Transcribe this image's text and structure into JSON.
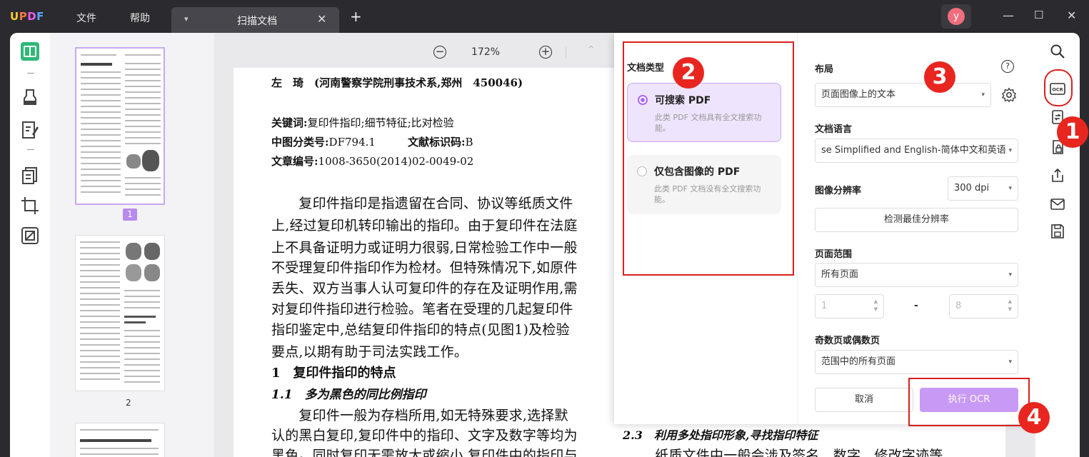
{
  "app": {
    "logo": "UPDF",
    "menu_file": "文件",
    "menu_help": "帮助",
    "tab_title": "扫描文档",
    "tab_dropdown": "▾",
    "tab_close": "✕",
    "new_tab": "+",
    "user_initial": "y"
  },
  "window": {
    "minimize": "—",
    "maximize": "☐",
    "close": "✕"
  },
  "toolbar": {
    "zoom_out": "−",
    "zoom": "172%",
    "zoom_in": "+",
    "nav_up": "⌃"
  },
  "thumbnails": {
    "page1_num": "1",
    "page2_num": "2"
  },
  "document": {
    "author_line": "左　琦　(河南警察学院刑事技术系,郑州　450046)",
    "keywords_label": "关键词:",
    "keywords_value": "复印件指印;细节特征;比对检验",
    "clc_label": "中图分类号:",
    "clc_value": "DF794.1",
    "doccode_label": "文献标识码:",
    "doccode_value": "B",
    "article_label": "文章编号:",
    "article_value": "1008-3650(2014)02-0049-02",
    "para1": [
      "　　复印件指印是指遗留在合同、协议等纸质文件",
      "上,经过复印机转印输出的指印。由于复印件在法庭",
      "上不具备证明力或证明力很弱,日常检验工作中一般",
      "不受理复印件指印作为检材。但特殊情况下,如原件",
      "丢失、双方当事人认可复印件的存在及证明作用,需",
      "对复印件指印进行检验。笔者在受理的几起复印件",
      "指印鉴定中,总结复印件指印的特点(见图1)及检验",
      "要点,以期有助于司法实践工作。"
    ],
    "heading1": "1　复印件指印的特点",
    "heading11": "1.1　多为黑色的同比例指印",
    "para2": [
      "　　复印件一般为存档所用,如无特殊要求,选择默",
      "认的黑白复印,复印件中的指印、文字及数字等均为",
      "黑色。同时复印无需放大或缩小,复印件中的指印与"
    ],
    "heading23": "2.3　利用多处指印形象,寻找指印特征",
    "para3": "　纸质文件中一般会涉及签名、数字、修改字迹等"
  },
  "ocr": {
    "doc_type_label": "文档类型",
    "opt1_title": "可搜索 PDF",
    "opt1_desc": "此类 PDF 文档具有全文搜索功能。",
    "opt2_title": "仅包含图像的 PDF",
    "opt2_desc": "此类 PDF 文档没有全文搜索功能。",
    "layout_label": "布局",
    "layout_value": "页面图像上的文本",
    "lang_label": "文档语言",
    "lang_value": "se Simplified and English-简体中文和英语",
    "res_label": "图像分辨率",
    "res_value": "300 dpi",
    "detect_btn": "检测最佳分辨率",
    "range_label": "页面范围",
    "range_value": "所有页面",
    "range_from": "1",
    "range_dash": "-",
    "range_to": "8",
    "oddeven_label": "奇数页或偶数页",
    "oddeven_value": "范围中的所有页面",
    "cancel": "取消",
    "run": "执行 OCR",
    "help": "?",
    "caret": "▾",
    "spin_arrows": "▲\n▼"
  },
  "annotations": {
    "n1": "1",
    "n2": "2",
    "n3": "3",
    "n4": "4"
  },
  "colors": {
    "accent": "#b88af0",
    "red": "#e8261f",
    "dark": "#2b2b2f"
  }
}
